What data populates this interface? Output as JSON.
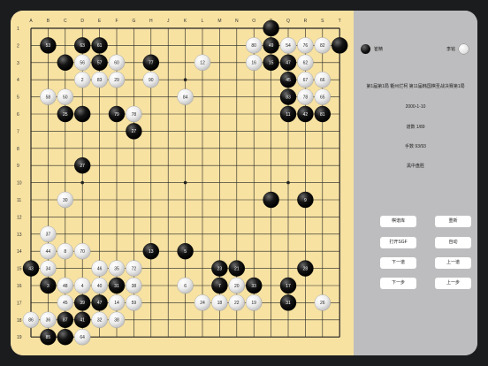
{
  "board": {
    "columns": [
      "A",
      "B",
      "C",
      "D",
      "E",
      "F",
      "G",
      "H",
      "J",
      "K",
      "L",
      "M",
      "N",
      "O",
      "P",
      "Q",
      "R",
      "S",
      "T"
    ],
    "rows": [
      "1",
      "2",
      "3",
      "4",
      "5",
      "6",
      "7",
      "8",
      "9",
      "10",
      "11",
      "12",
      "13",
      "14",
      "15",
      "16",
      "17",
      "18",
      "19"
    ],
    "stones": [
      {
        "c": "P",
        "r": 1,
        "color": "black",
        "n": ""
      },
      {
        "c": "B",
        "r": 2,
        "color": "black",
        "n": "53"
      },
      {
        "c": "D",
        "r": 2,
        "color": "black",
        "n": "63"
      },
      {
        "c": "E",
        "r": 2,
        "color": "black",
        "n": "61"
      },
      {
        "c": "O",
        "r": 2,
        "color": "white",
        "n": "80"
      },
      {
        "c": "P",
        "r": 2,
        "color": "black",
        "n": "49"
      },
      {
        "c": "Q",
        "r": 2,
        "color": "white",
        "n": "54"
      },
      {
        "c": "R",
        "r": 2,
        "color": "white",
        "n": "76"
      },
      {
        "c": "S",
        "r": 2,
        "color": "white",
        "n": "82"
      },
      {
        "c": "T",
        "r": 2,
        "color": "black",
        "n": ""
      },
      {
        "c": "C",
        "r": 3,
        "color": "black",
        "n": ""
      },
      {
        "c": "D",
        "r": 3,
        "color": "white",
        "n": "56"
      },
      {
        "c": "E",
        "r": 3,
        "color": "black",
        "n": "57"
      },
      {
        "c": "F",
        "r": 3,
        "color": "white",
        "n": "60"
      },
      {
        "c": "H",
        "r": 3,
        "color": "black",
        "n": "77"
      },
      {
        "c": "L",
        "r": 3,
        "color": "white",
        "n": "12"
      },
      {
        "c": "O",
        "r": 3,
        "color": "white",
        "n": "16"
      },
      {
        "c": "P",
        "r": 3,
        "color": "black",
        "n": "15"
      },
      {
        "c": "Q",
        "r": 3,
        "color": "black",
        "n": "47"
      },
      {
        "c": "R",
        "r": 3,
        "color": "white",
        "n": "62"
      },
      {
        "c": "D",
        "r": 4,
        "color": "white",
        "n": "2"
      },
      {
        "c": "E",
        "r": 4,
        "color": "white",
        "n": "83"
      },
      {
        "c": "F",
        "r": 4,
        "color": "white",
        "n": "29"
      },
      {
        "c": "H",
        "r": 4,
        "color": "white",
        "n": "90"
      },
      {
        "c": "Q",
        "r": 4,
        "color": "black",
        "n": "45"
      },
      {
        "c": "R",
        "r": 4,
        "color": "white",
        "n": "67"
      },
      {
        "c": "S",
        "r": 4,
        "color": "white",
        "n": "66"
      },
      {
        "c": "B",
        "r": 5,
        "color": "white",
        "n": "58"
      },
      {
        "c": "C",
        "r": 5,
        "color": "white",
        "n": "50"
      },
      {
        "c": "K",
        "r": 5,
        "color": "white",
        "n": "84"
      },
      {
        "c": "Q",
        "r": 5,
        "color": "black",
        "n": "83"
      },
      {
        "c": "R",
        "r": 5,
        "color": "white",
        "n": "78"
      },
      {
        "c": "S",
        "r": 5,
        "color": "white",
        "n": "65"
      },
      {
        "c": "C",
        "r": 6,
        "color": "black",
        "n": "25"
      },
      {
        "c": "D",
        "r": 6,
        "color": "black",
        "n": ""
      },
      {
        "c": "F",
        "r": 6,
        "color": "black",
        "n": "79"
      },
      {
        "c": "G",
        "r": 6,
        "color": "white",
        "n": "78"
      },
      {
        "c": "Q",
        "r": 6,
        "color": "black",
        "n": "11"
      },
      {
        "c": "R",
        "r": 6,
        "color": "black",
        "n": "42"
      },
      {
        "c": "S",
        "r": 6,
        "color": "black",
        "n": "81"
      },
      {
        "c": "G",
        "r": 7,
        "color": "black",
        "n": "27"
      },
      {
        "c": "D",
        "r": 9,
        "color": "black",
        "n": "27"
      },
      {
        "c": "P",
        "r": 11,
        "color": "black",
        "n": ""
      },
      {
        "c": "R",
        "r": 11,
        "color": "black",
        "n": "9"
      },
      {
        "c": "C",
        "r": 11,
        "color": "white",
        "n": "30"
      },
      {
        "c": "B",
        "r": 13,
        "color": "white",
        "n": "37"
      },
      {
        "c": "B",
        "r": 14,
        "color": "white",
        "n": "44"
      },
      {
        "c": "C",
        "r": 14,
        "color": "white",
        "n": "8"
      },
      {
        "c": "D",
        "r": 14,
        "color": "white",
        "n": "70"
      },
      {
        "c": "H",
        "r": 14,
        "color": "black",
        "n": "13"
      },
      {
        "c": "K",
        "r": 14,
        "color": "black",
        "n": "5"
      },
      {
        "c": "A",
        "r": 15,
        "color": "black",
        "n": "43"
      },
      {
        "c": "B",
        "r": 15,
        "color": "white",
        "n": "34"
      },
      {
        "c": "E",
        "r": 15,
        "color": "white",
        "n": "46"
      },
      {
        "c": "F",
        "r": 15,
        "color": "white",
        "n": "35"
      },
      {
        "c": "G",
        "r": 15,
        "color": "white",
        "n": "72"
      },
      {
        "c": "M",
        "r": 15,
        "color": "black",
        "n": "23"
      },
      {
        "c": "N",
        "r": 15,
        "color": "black",
        "n": "21"
      },
      {
        "c": "R",
        "r": 15,
        "color": "black",
        "n": "28"
      },
      {
        "c": "B",
        "r": 16,
        "color": "black",
        "n": "3"
      },
      {
        "c": "C",
        "r": 16,
        "color": "white",
        "n": "48"
      },
      {
        "c": "D",
        "r": 16,
        "color": "white",
        "n": "4"
      },
      {
        "c": "E",
        "r": 16,
        "color": "white",
        "n": "40"
      },
      {
        "c": "F",
        "r": 16,
        "color": "black",
        "n": "31"
      },
      {
        "c": "G",
        "r": 16,
        "color": "white",
        "n": "38"
      },
      {
        "c": "K",
        "r": 16,
        "color": "white",
        "n": "6"
      },
      {
        "c": "M",
        "r": 16,
        "color": "black",
        "n": "7"
      },
      {
        "c": "N",
        "r": 16,
        "color": "white",
        "n": "20"
      },
      {
        "c": "O",
        "r": 16,
        "color": "black",
        "n": "33"
      },
      {
        "c": "Q",
        "r": 16,
        "color": "black",
        "n": "17"
      },
      {
        "c": "C",
        "r": 17,
        "color": "white",
        "n": "45"
      },
      {
        "c": "D",
        "r": 17,
        "color": "black",
        "n": "39"
      },
      {
        "c": "E",
        "r": 17,
        "color": "black",
        "n": "47"
      },
      {
        "c": "F",
        "r": 17,
        "color": "white",
        "n": "14"
      },
      {
        "c": "G",
        "r": 17,
        "color": "white",
        "n": "59"
      },
      {
        "c": "L",
        "r": 17,
        "color": "white",
        "n": "24"
      },
      {
        "c": "M",
        "r": 17,
        "color": "white",
        "n": "18"
      },
      {
        "c": "N",
        "r": 17,
        "color": "white",
        "n": "22"
      },
      {
        "c": "O",
        "r": 17,
        "color": "white",
        "n": "19"
      },
      {
        "c": "Q",
        "r": 17,
        "color": "black",
        "n": "31"
      },
      {
        "c": "S",
        "r": 17,
        "color": "white",
        "n": "26"
      },
      {
        "c": "A",
        "r": 18,
        "color": "white",
        "n": "86"
      },
      {
        "c": "B",
        "r": 18,
        "color": "white",
        "n": "36"
      },
      {
        "c": "C",
        "r": 18,
        "color": "black",
        "n": "87"
      },
      {
        "c": "D",
        "r": 18,
        "color": "black",
        "n": "41"
      },
      {
        "c": "E",
        "r": 18,
        "color": "white",
        "n": "32"
      },
      {
        "c": "F",
        "r": 18,
        "color": "white",
        "n": "38"
      },
      {
        "c": "B",
        "r": 19,
        "color": "black",
        "n": "85"
      },
      {
        "c": "C",
        "r": 19,
        "color": "black",
        "n": ""
      },
      {
        "c": "D",
        "r": 19,
        "color": "white",
        "n": "64"
      }
    ]
  },
  "panel": {
    "black_player": "崔精",
    "white_player": "李铭",
    "game_title": "第1届第1局 衢州烂柯 第11届韩国棋圣战决赛第1局",
    "date": "2000-1-10",
    "moves": "谱数 1/89",
    "move_count": "手数 93/93",
    "result": "黑中盘胜",
    "buttons": {
      "save": "棋谱库",
      "reset": "重新",
      "open_sgf": "打开SGF",
      "auto": "自动",
      "next_game": "下一谱",
      "prev_game": "上一谱",
      "next_move": "下一步",
      "prev_move": "上一步"
    }
  },
  "colors": {
    "board": "#f7e2a2",
    "panel": "#bdbdbf",
    "bezel": "#1b1c1e"
  }
}
